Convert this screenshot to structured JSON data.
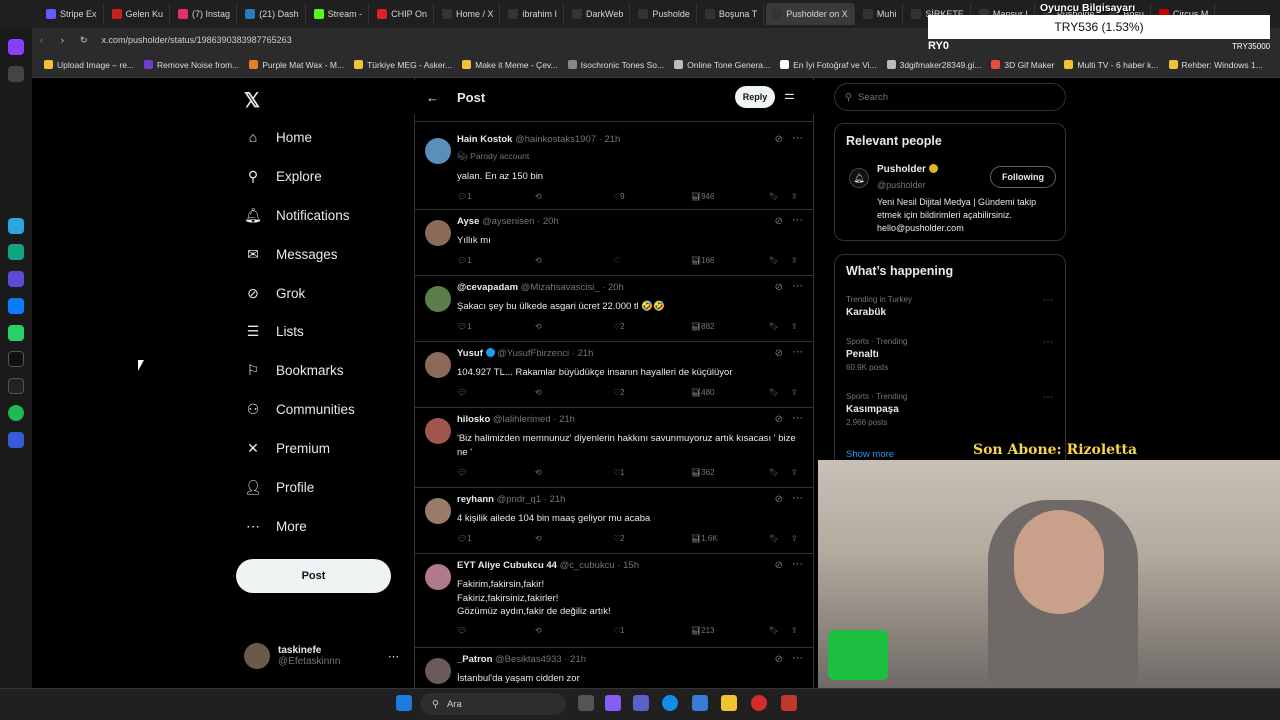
{
  "browser": {
    "tabs": [
      "Stripe Ex",
      "Gelen Ku",
      "(7) Instag",
      "(21) Dash",
      "Stream -",
      "CHIP On",
      "Home / X",
      "ibrahim I",
      "DarkWeb",
      "Pusholde",
      "Boşuna T",
      "Pusholder on X",
      "Muhi",
      "ŞİRKETE",
      "Mansur I",
      "Pusholde",
      "Boşu",
      "Circus M"
    ],
    "active_tab_index": 11,
    "url": "x.com/pusholder/status/1986390383987765263",
    "bookmarks": [
      "Upload Image – re...",
      "Remove Noise from...",
      "Purple Mat Wax - M...",
      "Türkiye MEG - Asker...",
      "Make it Meme - Çev...",
      "Isochronic Tones So...",
      "Online Tone Genera...",
      "En İyi Fotoğraf ve Vi...",
      "3dgifmaker28349.gi...",
      "3D Gif Maker",
      "Multi TV - 6 haber k...",
      "Rehber: Windows 1..."
    ]
  },
  "nav": {
    "home": "Home",
    "explore": "Explore",
    "notifications": "Notifications",
    "messages": "Messages",
    "grok": "Grok",
    "lists": "Lists",
    "bookmarks": "Bookmarks",
    "communities": "Communities",
    "premium": "Premium",
    "profile": "Profile",
    "more": "More",
    "post_button": "Post",
    "account_name": "taskinefe",
    "account_handle": "@Efetaskinnn"
  },
  "header": {
    "title": "Post",
    "reply_button": "Reply"
  },
  "tweets": [
    {
      "name": "Hain Kostok",
      "handle": "@hainkostaks1907",
      "time": "21h",
      "badge": "Parody account",
      "text": "yalan. En az 150 bin",
      "replies": "1",
      "retweets": "",
      "likes": "9",
      "views": "946"
    },
    {
      "name": "Ayse",
      "handle": "@aysenisen",
      "time": "20h",
      "text": "Yıllık mı",
      "replies": "1",
      "retweets": "",
      "likes": "",
      "views": "166"
    },
    {
      "name": "@cevapadam",
      "handle": "@Mizahsavascisi_",
      "time": "20h",
      "text": "Şakacı şey bu ülkede asgari ücret 22.000 tl 🤣🤣",
      "replies": "1",
      "retweets": "",
      "likes": "2",
      "views": "882"
    },
    {
      "name": "Yusuf",
      "handle": "@YusufFbirzenci",
      "time": "21h",
      "text": "104.927 TL... Rakamlar büyüdükçe insanın hayalleri de küçülüyor",
      "replies": "",
      "retweets": "",
      "likes": "2",
      "views": "480"
    },
    {
      "name": "hilosko",
      "handle": "@lalihlerimed",
      "time": "21h",
      "text": "'Biz halimizden memnunuz' diyenlerin hakkını savunmuyoruz artık kısacası ' bize ne '",
      "replies": "",
      "retweets": "",
      "likes": "1",
      "views": "362"
    },
    {
      "name": "reyhann",
      "handle": "@pndr_q1",
      "time": "21h",
      "text": "4 kişilik ailede 104 bin maaş geliyor mu acaba",
      "replies": "1",
      "retweets": "",
      "likes": "2",
      "views": "1.6K"
    },
    {
      "name": "EYT Aliye Cubukcu 44",
      "handle": "@c_cubukcu",
      "time": "15h",
      "text": "Fakirim,fakirsin,fakir!\nFakiriz,fakirsiniz,fakirler!\nGözümüz aydın,fakir de değiliz artık!",
      "replies": "",
      "retweets": "",
      "likes": "1",
      "views": "213"
    },
    {
      "name": "_Patron",
      "handle": "@Besiktas4933",
      "time": "21h",
      "text": "İstanbul'da yaşam cidden zor",
      "replies": "",
      "retweets": "",
      "likes": "",
      "views": ""
    }
  ],
  "right": {
    "search_placeholder": "Search",
    "relevant_title": "Relevant people",
    "person_name": "Pusholder",
    "person_handle": "@pusholder",
    "follow_button": "Following",
    "person_bio": "Yeni Nesil Dijital Medya | Gündemi takip etmek için bildirimleri açabilirsiniz. hello@pusholder.com",
    "happening_title": "What’s happening",
    "trends": [
      {
        "meta": "Trending in Turkey",
        "name": "Karabük",
        "count": ""
      },
      {
        "meta": "Sports · Trending",
        "name": "Penaltı",
        "count": "60.9K posts"
      },
      {
        "meta": "Sports · Trending",
        "name": "Kasımpaşa",
        "count": "2,966 posts"
      }
    ],
    "show_more": "Show more"
  },
  "overlay": {
    "ticker_head": "Oyuncu Bilgisayarı",
    "ticker": "TRY536 (1.53%)",
    "ryo": "RY0",
    "try_right": "TRY35000",
    "subscriber": "Son Abone: Rizoletta"
  },
  "taskbar": {
    "search": "Ara"
  }
}
